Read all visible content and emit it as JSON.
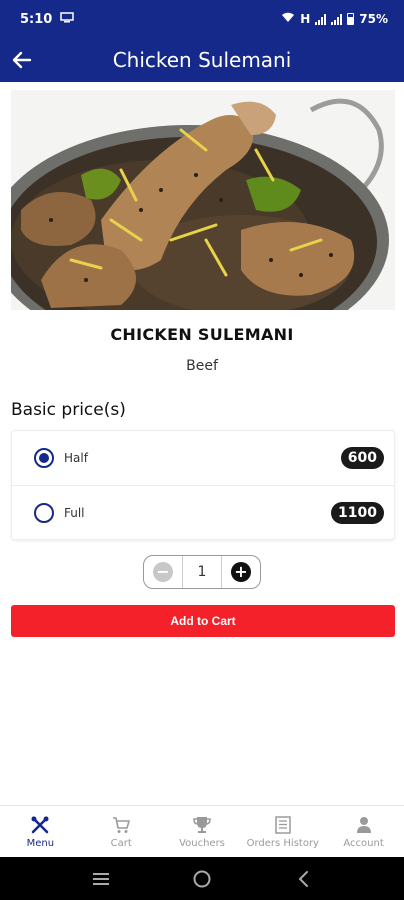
{
  "status_bar": {
    "time": "5:10",
    "network_label": "H",
    "battery": "75%"
  },
  "app_bar": {
    "title": "Chicken Sulemani"
  },
  "dish": {
    "name": "CHICKEN SULEMANI",
    "category": "Beef"
  },
  "prices": {
    "heading": "Basic price(s)",
    "options": [
      {
        "label": "Half",
        "price": "600",
        "selected": true
      },
      {
        "label": "Full",
        "price": "1100",
        "selected": false
      }
    ]
  },
  "quantity": {
    "value": "1"
  },
  "add_to_cart": {
    "label": "Add to Cart"
  },
  "bottom_nav": {
    "items": [
      {
        "label": "Menu",
        "icon": "fork-knife-icon",
        "active": true
      },
      {
        "label": "Cart",
        "icon": "cart-icon",
        "active": false
      },
      {
        "label": "Vouchers",
        "icon": "trophy-icon",
        "active": false
      },
      {
        "label": "Orders History",
        "icon": "receipt-icon",
        "active": false
      },
      {
        "label": "Account",
        "icon": "person-icon",
        "active": false
      }
    ]
  },
  "colors": {
    "primary": "#15298a",
    "accent": "#f4202a",
    "pill": "#1a1a1a"
  }
}
